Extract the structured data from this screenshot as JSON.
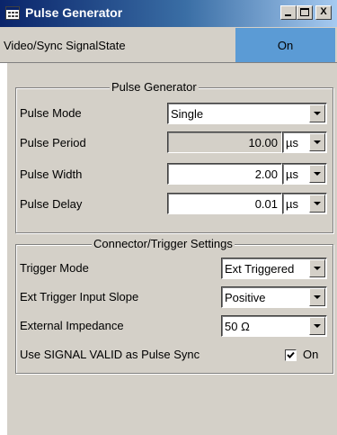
{
  "window": {
    "title": "Pulse Generator",
    "controls": {
      "minimize": "_",
      "maximize": "□",
      "close": "X"
    }
  },
  "status": {
    "label": "Video/Sync SignalState",
    "value": "On",
    "value_color": "#5b9bd5"
  },
  "pulse_generator": {
    "title": "Pulse Generator",
    "rows": {
      "mode": {
        "label": "Pulse Mode",
        "value": "Single"
      },
      "period": {
        "label": "Pulse Period",
        "value": "10.00",
        "unit": "µs"
      },
      "width": {
        "label": "Pulse Width",
        "value": "2.00",
        "unit": "µs"
      },
      "delay": {
        "label": "Pulse Delay",
        "value": "0.01",
        "unit": "µs"
      }
    }
  },
  "connector_trigger": {
    "title": "Connector/Trigger Settings",
    "rows": {
      "trigger_mode": {
        "label": "Trigger Mode",
        "value": "Ext Triggered"
      },
      "ext_slope": {
        "label": "Ext Trigger Input Slope",
        "value": "Positive"
      },
      "impedance": {
        "label": "External Impedance",
        "value": "50 Ω"
      },
      "signal_valid": {
        "label": "Use SIGNAL VALID as Pulse Sync",
        "checked": true,
        "check_label": "On"
      }
    }
  },
  "colors": {
    "window_bg": "#d4d0c8",
    "titlebar_start": "#0a246a",
    "titlebar_end": "#a6caf0",
    "highlight": "#5b9bd5"
  }
}
